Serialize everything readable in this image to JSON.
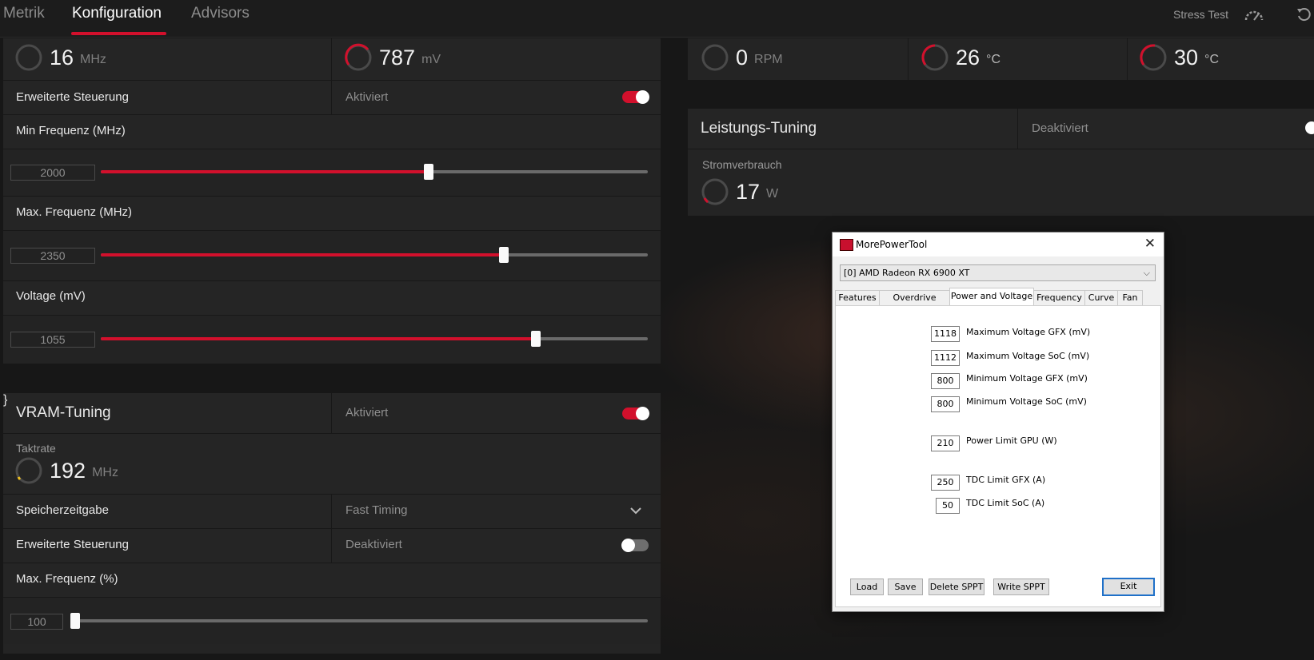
{
  "nav": {
    "tabs": [
      {
        "label": "Metrik"
      },
      {
        "label": "Konfiguration"
      },
      {
        "label": "Advisors"
      }
    ],
    "stress_test": "Stress Test"
  },
  "gpu_panel": {
    "clock": {
      "value": "16",
      "unit": "MHz"
    },
    "voltage": {
      "value": "787",
      "unit": "mV"
    },
    "advanced_control": {
      "label": "Erweiterte Steuerung",
      "status": "Aktiviert"
    },
    "min_freq": {
      "label": "Min Frequenz (MHz)",
      "value": "2000",
      "fraction": 0.6
    },
    "max_freq": {
      "label": "Max. Frequenz (MHz)",
      "value": "2350",
      "fraction": 0.737
    },
    "voltage_slider": {
      "label": "Voltage (mV)",
      "value": "1055",
      "fraction": 0.796
    }
  },
  "vram_panel": {
    "title": "VRAM-Tuning",
    "status": "Aktiviert",
    "clock_label": "Taktrate",
    "clock": {
      "value": "192",
      "unit": "MHz"
    },
    "timing": {
      "label": "Speicherzeitgabe",
      "value": "Fast Timing"
    },
    "advanced_control": {
      "label": "Erweiterte Steuerung",
      "status": "Deaktiviert"
    },
    "max_freq": {
      "label": "Max. Frequenz (%)",
      "value": "100",
      "fraction": 0.0
    }
  },
  "fan_panel": {
    "fan": {
      "value": "0",
      "unit": "RPM"
    },
    "temp1": {
      "value": "26",
      "unit": "°C"
    },
    "temp2": {
      "value": "30",
      "unit": "°C"
    }
  },
  "power_panel": {
    "title": "Leistungs-Tuning",
    "status": "Deaktiviert",
    "consumption_label": "Stromverbrauch",
    "consumption": {
      "value": "17",
      "unit": "W"
    }
  },
  "mpt": {
    "title": "MorePowerTool",
    "gpu_select": "[0] AMD Radeon RX 6900 XT",
    "tabs": [
      {
        "label": "Features"
      },
      {
        "label": "Overdrive Limits"
      },
      {
        "label": "Power and Voltage"
      },
      {
        "label": "Frequency"
      },
      {
        "label": "Curve"
      },
      {
        "label": "Fan"
      }
    ],
    "fields": [
      {
        "value": "1118",
        "label": "Maximum Voltage GFX (mV)"
      },
      {
        "value": "1112",
        "label": "Maximum Voltage SoC (mV)"
      },
      {
        "value": "800",
        "label": "Minimum Voltage GFX (mV)"
      },
      {
        "value": "800",
        "label": "Minimum Voltage SoC (mV)"
      },
      {
        "value": "210",
        "label": "Power Limit GPU (W)"
      },
      {
        "value": "250",
        "label": "TDC Limit GFX (A)"
      },
      {
        "value": "50",
        "label": "TDC Limit SoC (A)"
      }
    ],
    "buttons": {
      "load": "Load",
      "save": "Save",
      "delete_sppt": "Delete SPPT",
      "write_sppt": "Write SPPT",
      "exit": "Exit"
    }
  },
  "colors": {
    "accent": "#d2102c",
    "panel": "#242424",
    "background": "#151515"
  }
}
